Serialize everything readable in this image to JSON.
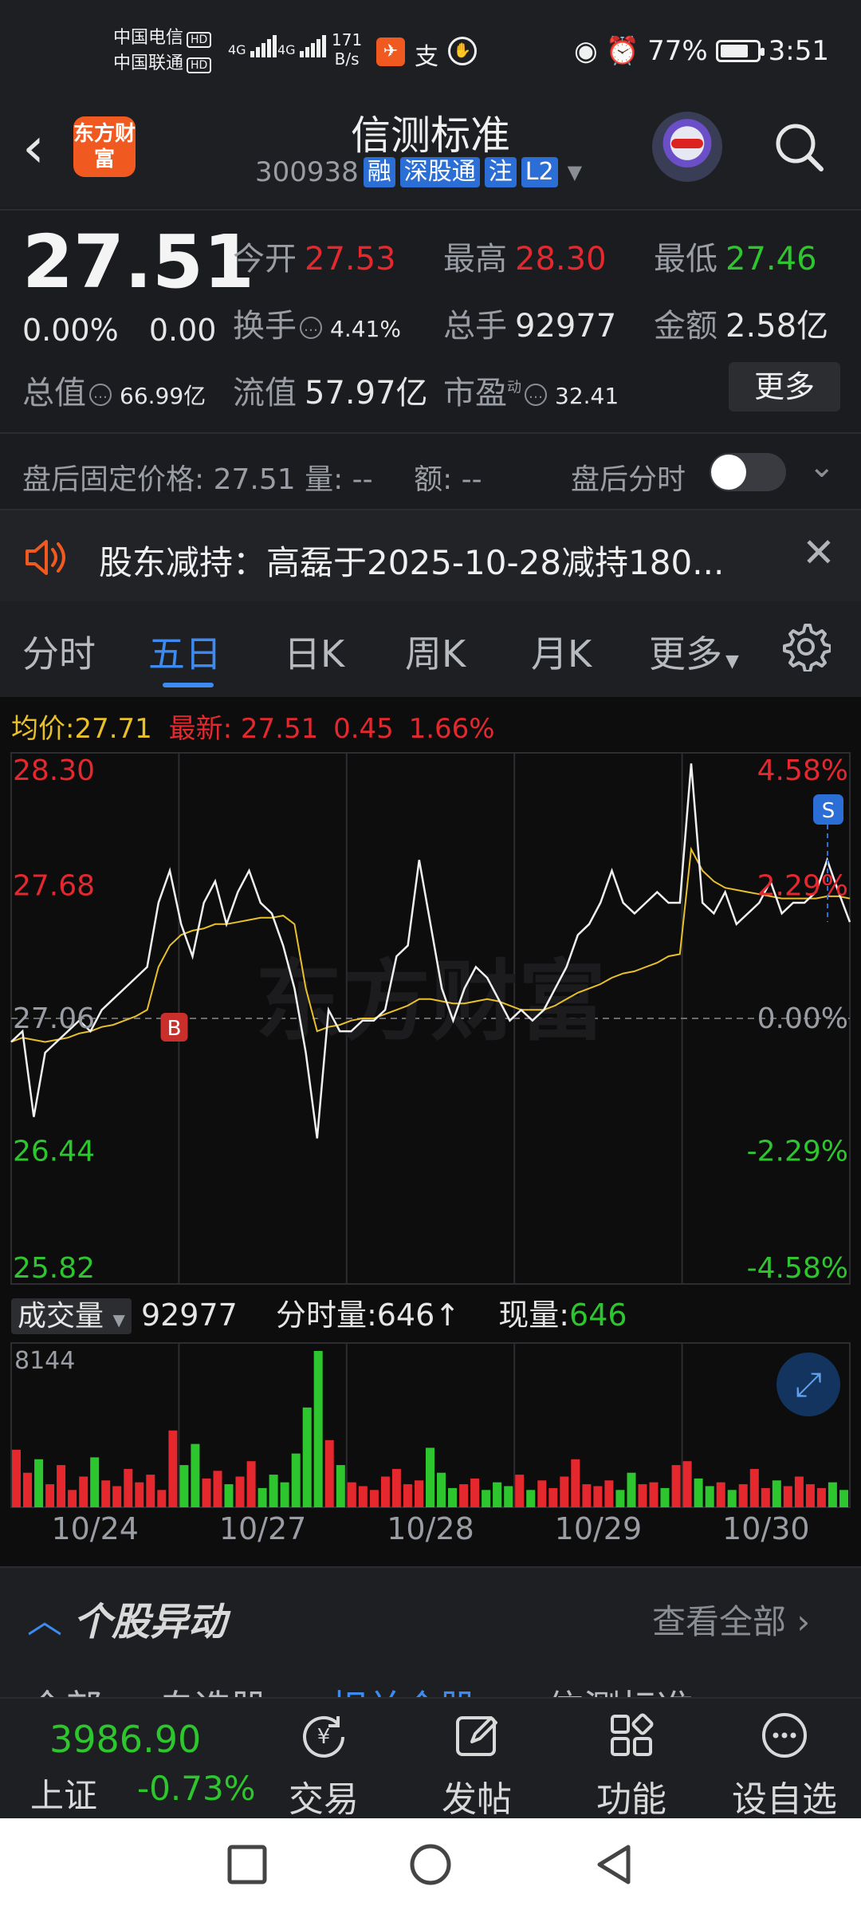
{
  "status_bar": {
    "carrier1": "中国电信",
    "carrier2": "中国联通",
    "hd": "HD",
    "net1": "4G",
    "net2": "4G",
    "speed_value": "171",
    "speed_unit": "B/s",
    "battery_percent": "77%",
    "battery_level": 0.77,
    "time": "3:51"
  },
  "header": {
    "logo_text": "东方财富",
    "stock_name": "信测标准",
    "stock_code": "300938",
    "tags": [
      "融",
      "深股通",
      "注",
      "L2"
    ]
  },
  "quote": {
    "price": "27.51",
    "change_pct": "0.00%",
    "change_val": "0.00",
    "open_label": "今开",
    "open": "27.53",
    "high_label": "最高",
    "high": "28.30",
    "low_label": "最低",
    "low": "27.46",
    "turnover_label": "换手",
    "turnover": "4.41%",
    "volume_label": "总手",
    "volume": "92977",
    "amount_label": "金额",
    "amount": "2.58亿",
    "mktcap_label": "总值",
    "mktcap": "66.99亿",
    "float_label": "流值",
    "float": "57.97亿",
    "pe_label": "市盈",
    "pe_sup": "动",
    "pe": "32.41",
    "more_label": "更多"
  },
  "after_hours": {
    "label": "盘后固定价格: 27.51 量: -- ",
    "amount": "额: --",
    "toggle_label": "盘后分时"
  },
  "notice": {
    "text": "股东减持：高磊于2025-10-28减持180..."
  },
  "tabs": [
    "分时",
    "五日",
    "日K",
    "周K",
    "月K",
    "更多"
  ],
  "chart_info": {
    "avg_label": "均价:",
    "avg_value": "27.71",
    "latest_label": "最新:",
    "latest_value": "27.51",
    "latest_chg": "0.45",
    "latest_pct": "1.66%",
    "marker_buy": "B",
    "marker_sell": "S",
    "watermark": "东方财富"
  },
  "chart_data": {
    "type": "line",
    "title": "",
    "y_labels_left": [
      "28.30",
      "27.68",
      "27.06",
      "26.44",
      "25.82"
    ],
    "y_labels_right": [
      "4.58%",
      "2.29%",
      "0.00%",
      "-2.29%",
      "-4.58%"
    ],
    "ylim": [
      25.82,
      28.3
    ],
    "reference_price": 27.06,
    "x_labels": [
      "10/24",
      "10/27",
      "10/28",
      "10/29",
      "10/30"
    ],
    "series": [
      {
        "name": "",
        "values": [
          26.95,
          27.0,
          26.6,
          26.9,
          26.95,
          27.0,
          27.05,
          27.0,
          27.1,
          27.15,
          27.2,
          27.25,
          27.3,
          27.6,
          27.75,
          27.5,
          27.35,
          27.6,
          27.7,
          27.5,
          27.65,
          27.75,
          27.6,
          27.55,
          27.4,
          27.2,
          26.9,
          26.5,
          27.1,
          27.0,
          27.0,
          27.05,
          27.05,
          27.1,
          27.35,
          27.4,
          27.8,
          27.5,
          27.2,
          27.05,
          27.2,
          27.3,
          27.25,
          27.15,
          27.05,
          27.1,
          27.05,
          27.1,
          27.2,
          27.3,
          27.45,
          27.5,
          27.6,
          27.75,
          27.6,
          27.55,
          27.6,
          27.65,
          27.6,
          27.6,
          28.25,
          27.6,
          27.55,
          27.65,
          27.5,
          27.55,
          27.6,
          27.7,
          27.55,
          27.6,
          27.6,
          27.65,
          27.8,
          27.65,
          27.51
        ]
      },
      {
        "name": "均价",
        "values": [
          26.95,
          26.97,
          26.96,
          26.95,
          26.96,
          26.97,
          26.99,
          27.0,
          27.02,
          27.03,
          27.05,
          27.07,
          27.1,
          27.3,
          27.4,
          27.45,
          27.47,
          27.48,
          27.5,
          27.5,
          27.51,
          27.52,
          27.53,
          27.53,
          27.54,
          27.5,
          27.2,
          27.0,
          27.02,
          27.03,
          27.05,
          27.06,
          27.06,
          27.08,
          27.1,
          27.12,
          27.15,
          27.15,
          27.14,
          27.13,
          27.13,
          27.14,
          27.15,
          27.14,
          27.12,
          27.1,
          27.1,
          27.1,
          27.12,
          27.15,
          27.18,
          27.2,
          27.22,
          27.25,
          27.27,
          27.28,
          27.3,
          27.32,
          27.35,
          27.36,
          27.85,
          27.75,
          27.7,
          27.67,
          27.66,
          27.65,
          27.64,
          27.63,
          27.62,
          27.62,
          27.62,
          27.62,
          27.63,
          27.63,
          27.62
        ]
      }
    ],
    "volume_max_label": "8144",
    "volume_series": {
      "name": "成交量",
      "values": [
        3000,
        1800,
        2500,
        1200,
        2200,
        900,
        1600,
        2600,
        1400,
        1100,
        2000,
        1300,
        1700,
        900,
        4000,
        2200,
        3300,
        1500,
        1900,
        1200,
        1600,
        2400,
        1000,
        1700,
        1300,
        2800,
        5200,
        8144,
        3500,
        2200,
        1300,
        1100,
        900,
        1600,
        2000,
        1200,
        1400,
        3100,
        1800,
        1000,
        1200,
        1500,
        900,
        1300,
        1100,
        1700,
        900,
        1400,
        1000,
        1600,
        2500,
        1200,
        1100,
        1400,
        900,
        1800,
        1200,
        1300,
        1000,
        2200,
        2400,
        1500,
        1100,
        1300,
        900,
        1200,
        2000,
        1000,
        1400,
        1100,
        1600,
        1200,
        1000,
        1300,
        900
      ]
    }
  },
  "volume_legend": {
    "selector": "成交量",
    "total": "92977",
    "minute_label": "分时量:",
    "minute_value": "646",
    "arrow": "↑",
    "now_label": "现量:",
    "now_value": "646"
  },
  "movers": {
    "title": "个股异动",
    "view_all": "查看全部"
  },
  "subtabs": [
    "全部",
    "自选股",
    "相关个股",
    "信测标准"
  ],
  "bottom_nav": {
    "index_value": "3986.90",
    "index_name": "上证",
    "index_change": "-0.73%",
    "items": [
      "交易",
      "发帖",
      "功能",
      "设自选"
    ]
  },
  "colors": {
    "up": "#e5282e",
    "down": "#2ec62e",
    "accent": "#3d8af0",
    "avg": "#e8c02a"
  }
}
